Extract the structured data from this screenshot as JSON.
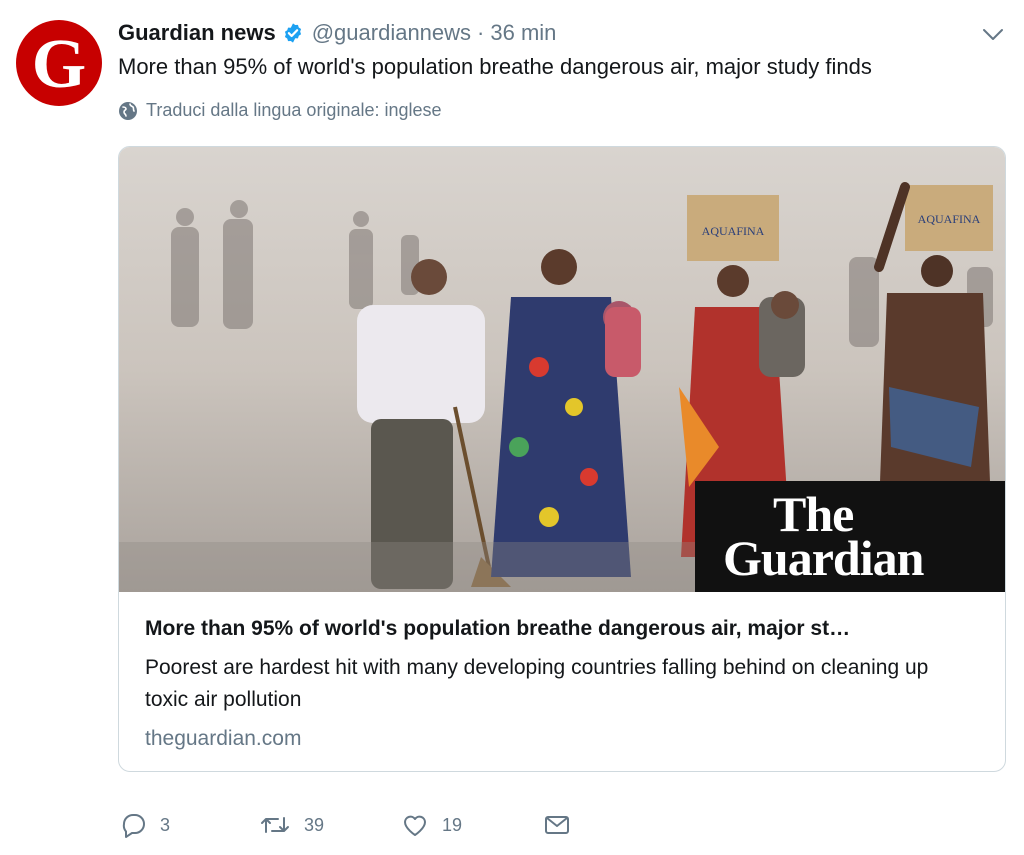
{
  "tweet": {
    "author_name": "Guardian news",
    "handle": "@guardiannews",
    "separator": "·",
    "time": "36 min",
    "avatar_letter": "G",
    "text": "More than 95% of world's population breathe dangerous air, major study finds",
    "translate_label": "Traduci dalla lingua originale: inglese"
  },
  "card": {
    "logo_line1": "The",
    "logo_line2": "Guardian",
    "title": "More than 95% of world's population breathe dangerous air, major st…",
    "description": "Poorest are hardest hit with many developing countries falling behind on cleaning up toxic air pollution",
    "domain": "theguardian.com",
    "box_label_1": "AQUAFINA",
    "box_label_2": "AQUAFINA"
  },
  "actions": {
    "reply_count": "3",
    "retweet_count": "39",
    "like_count": "19"
  },
  "colors": {
    "brand_red": "#c70000",
    "verified_blue": "#1da1f2",
    "secondary_text": "#657786"
  },
  "icons": [
    "verified-icon",
    "chevron-down-icon",
    "globe-icon",
    "reply-icon",
    "retweet-icon",
    "like-icon",
    "dm-icon"
  ]
}
